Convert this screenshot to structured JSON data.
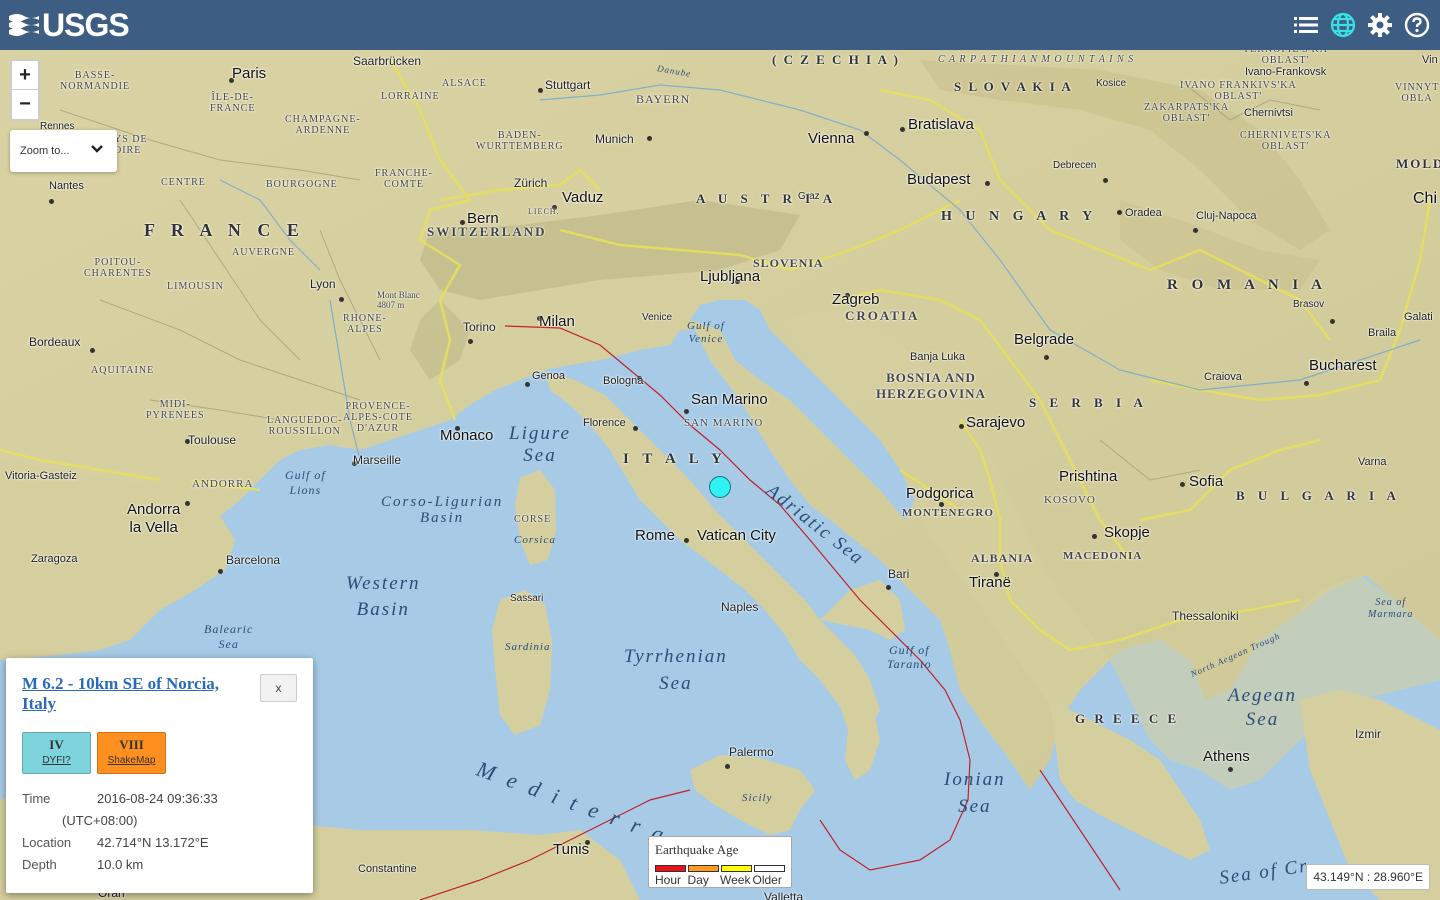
{
  "header": {
    "logo_text": "USGS",
    "icons": [
      "list-icon",
      "globe-icon",
      "gear-icon",
      "help-icon"
    ]
  },
  "map": {
    "zoom_in": "+",
    "zoom_out": "−",
    "zoom_to_label": "Zoom to...",
    "labels": {
      "paris": "Paris",
      "saarbrucken": "Saarbrücken",
      "stuttgart": "Stuttgart",
      "munich": "Munich",
      "vienna": "Vienna",
      "bratislava": "Bratislava",
      "budapest": "Budapest",
      "zurich": "Zürich",
      "vaduz": "Vaduz",
      "bern": "Bern",
      "lyon": "Lyon",
      "milan": "Milan",
      "torino": "Torino",
      "venice": "Venice",
      "ljubljana": "Ljubljana",
      "zagreb": "Zagreb",
      "graz": "Graz",
      "debrecen": "Debrecen",
      "oradea": "Oradea",
      "cluj": "Cluj-Napoca",
      "brasov": "Brasov",
      "bucharest": "Bucharest",
      "belgrade": "Belgrade",
      "banja": "Banja Luka",
      "sarajevo": "Sarajevo",
      "podgorica": "Podgorica",
      "prishtina": "Prishtina",
      "skopje": "Skopje",
      "tirane": "Tiranë",
      "sofia": "Sofia",
      "varna": "Varna",
      "craiova": "Craiova",
      "thessaloniki": "Thessaloniki",
      "athens": "Athens",
      "izmir": "Izmir",
      "bari": "Bari",
      "naples": "Naples",
      "rome": "Rome",
      "vatican": "Vatican City",
      "sanmarino": "San Marino",
      "sanmarino_c": "SAN MARINO",
      "florence": "Florence",
      "bologna": "Bologna",
      "genoa": "Genoa",
      "monaco": "Monaco",
      "marseille": "Marseille",
      "toulouse": "Toulouse",
      "bordeaux": "Bordeaux",
      "nantes": "Nantes",
      "rennes": "Rennes",
      "andorra": "Andorra\nla Vella",
      "barcelona": "Barcelona",
      "zaragoza": "Zaragoza",
      "vitoria": "Vitoria-Gasteiz",
      "palermo": "Palermo",
      "tunis": "Tunis",
      "constantine": "Constantine",
      "oran": "Oran",
      "sassari": "Sassari",
      "galati": "Galati",
      "braila": "Braila",
      "kosice": "Kosice",
      "ivano": "Ivano-Frankovsk",
      "chernivtsi": "Chernivtsi",
      "chi": "Chi",
      "montblanc": "Mont Blanc\n4807 m",
      "valletta": "Valletta",
      "france": "F R A N C E",
      "italy": "I T A L Y",
      "austria": "A U S T R I A",
      "hungary": "H U N G A R Y",
      "romania": "R O M A N I A",
      "serbia": "S E R B I A",
      "bulgaria": "B U L G A R I A",
      "greece": "G R E E C E",
      "croatia": "CROATIA",
      "slovenia": "SLOVENIA",
      "slovakia": "S L O V A K I A",
      "czechia": "( C Z E C H I A )",
      "switzerland": "SWITZERLAND",
      "bosnia": "BOSNIA AND\nHERZEGOVINA",
      "montenegro": "MONTENEGRO",
      "albania": "ALBANIA",
      "macedonia": "MACEDONIA",
      "kosovo": "KOSOVO",
      "moldova": "MOLDOV",
      "andorra_c": "ANDORRA",
      "liech": "LIECH.",
      "bayern": "BAYERN",
      "baden": "BADEN-\nWURTTEMBERG",
      "alsace": "ALSACE",
      "lorraine": "LORRAINE",
      "champagne": "CHAMPAGNE-\nARDENNE",
      "basse": "BASSE-\nNORMANDIE",
      "iledefrance": "ÎLE-DE-\nFRANCE",
      "centre": "CENTRE",
      "bourgogne": "BOURGOGNE",
      "franchecomte": "FRANCHE-\nCOMTE",
      "poitou": "POITOU-\nCHARENTES",
      "limousin": "LIMOUSIN",
      "auvergne": "AUVERGNE",
      "rhone": "RHONE-\nALPES",
      "aquitaine": "AQUITAINE",
      "midi": "MIDI-\nPYRENEES",
      "languedoc": "LANGUEDOC-\nROUSSILLON",
      "provence": "PROVENCE-\nALPES-COTE\nD'AZUR",
      "corse": "CORSE",
      "corsica": "Corsica",
      "sardinia": "Sardinia",
      "sicily": "Sicily",
      "paysde": "YS DE\nOIRE",
      "ivano_obl": "IVANO FRANKIVS'KA\nOBLAST'",
      "zakarpat": "ZAKARPATS'KA\nOBLAST'",
      "cherniv_obl": "CHERNIVETS'KA\nOBLAST'",
      "tern": "TERNOPIL'S'KA\nOBLAST'",
      "vinny": "VINNYT\nOBLA",
      "vin": "Vin",
      "ligurian": "Ligure\nSea",
      "adriatic": "Adriatic Sea",
      "tyrrhenian": "Tyrrhenian\nSea",
      "ionian": "Ionian\nSea",
      "aegean": "Aegean\nSea",
      "mediterranean": "M e d i t e r r a n e a n",
      "western": "Western\nBasin",
      "corso": "Corso-Ligurian\nBasin",
      "balearic": "Balearic\nSea",
      "lions": "Gulf of\nLions",
      "venicegulf": "Gulf of\nVenice",
      "taranto": "Gulf of\nTaranto",
      "marmara": "Sea of\nMarmara",
      "northaegean": "North Aegean Trough",
      "carpathian": "C A R P A T H I A N   M O U N T A I N S",
      "danube": "Danube",
      "seaofcrete": "Sea of Cr"
    }
  },
  "popup": {
    "title": "M 6.2 - 10km SE of Norcia, Italy",
    "close_label": "x",
    "dyfi": {
      "value": "IV",
      "label": "DYFI?",
      "color": "#7dd4dc"
    },
    "shakemap": {
      "value": "VIII",
      "label": "ShakeMap",
      "color": "#ff9020"
    },
    "time_label": "Time",
    "time_value": "2016-08-24 09:36:33",
    "timezone": "(UTC+08:00)",
    "location_label": "Location",
    "location_value": "42.714°N 13.172°E",
    "depth_label": "Depth",
    "depth_value": "10.0 km"
  },
  "legend": {
    "title": "Earthquake Age",
    "items": [
      {
        "label": "Hour",
        "color": "#e8141a"
      },
      {
        "label": "Day",
        "color": "#ff9b1e"
      },
      {
        "label": "Week",
        "color": "#ffff00"
      },
      {
        "label": "Older",
        "color": "#ffffff"
      }
    ]
  },
  "coordinates": "43.149°N : 28.960°E",
  "earthquake": {
    "color": "#2ff2f2",
    "lat": 42.714,
    "lon": 13.172
  }
}
